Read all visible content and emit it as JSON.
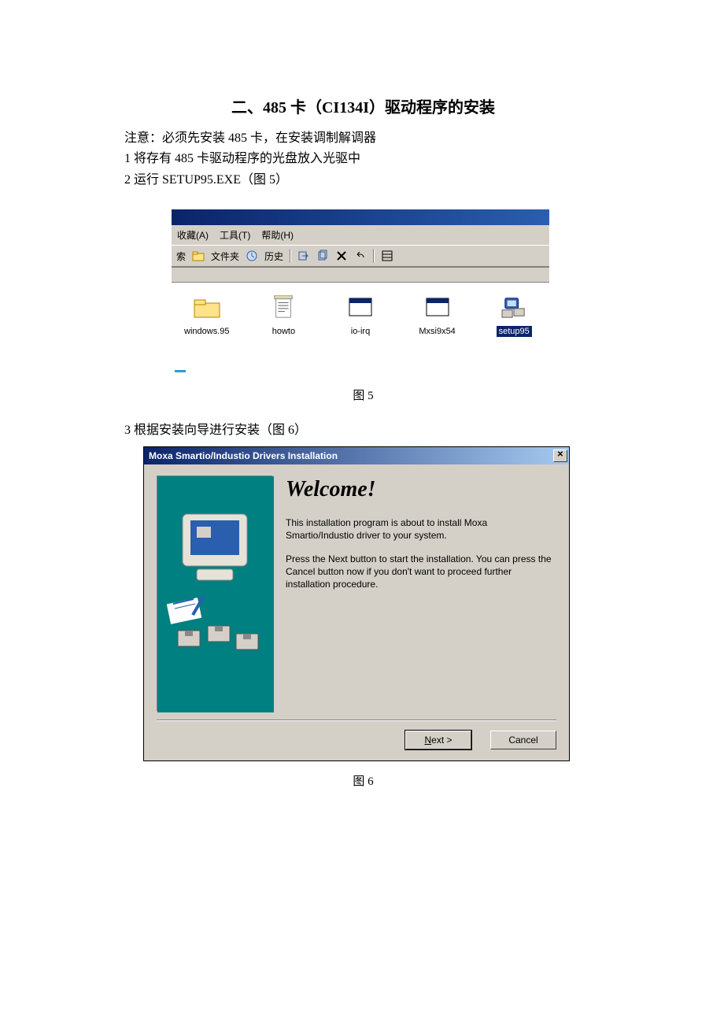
{
  "title": "二、485 卡（CI134I）驱动程序的安装",
  "notice": "注意：必须先安装 485 卡，在安装调制解调器",
  "step1": "1 将存有 485 卡驱动程序的光盘放入光驱中",
  "step2": "2 运行 SETUP95.EXE（图 5）",
  "caption5": "图 5",
  "step3": "3 根据安装向导进行安装（图 6）",
  "caption6": "图 6",
  "explorer": {
    "menu": {
      "fav": "收藏(A)",
      "tool": "工具(T)",
      "help": "帮助(H)"
    },
    "toolbar": {
      "search": "索",
      "folders": "文件夹",
      "history": "历史"
    },
    "items": [
      {
        "name": "windows.95",
        "type": "folder",
        "selected": false
      },
      {
        "name": "howto",
        "type": "text",
        "selected": false
      },
      {
        "name": "io-irq",
        "type": "exe",
        "selected": false
      },
      {
        "name": "Mxsi9x54",
        "type": "exe",
        "selected": false
      },
      {
        "name": "setup95",
        "type": "setup",
        "selected": true
      }
    ]
  },
  "installer": {
    "title": "Moxa Smartio/Industio Drivers Installation",
    "heading": "Welcome!",
    "p1": "This installation program is about to install Moxa Smartio/Industio driver to your system.",
    "p2": "Press the Next button to start the installation. You can press the Cancel button now if you don't want to proceed further installation procedure.",
    "next": "Next >",
    "cancel": "Cancel"
  }
}
